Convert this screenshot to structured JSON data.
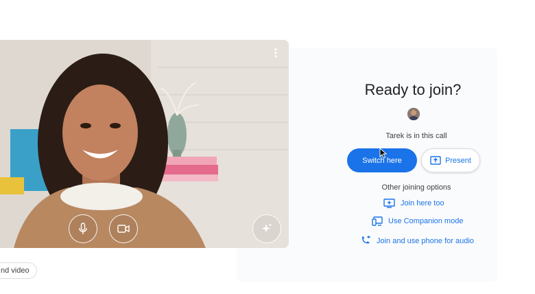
{
  "preview": {
    "chip_label": "nd video"
  },
  "panel": {
    "title": "Ready to join?",
    "in_call_text": "Tarek is in this call",
    "switch_label": "Switch here",
    "present_label": "Present",
    "other_options_label": "Other joining options",
    "options": [
      {
        "label": "Join here too",
        "icon": "add-to-screen-icon"
      },
      {
        "label": "Use Companion mode",
        "icon": "companion-devices-icon"
      },
      {
        "label": "Join and use phone for audio",
        "icon": "phone-forward-icon"
      }
    ]
  },
  "colors": {
    "accent": "#1a73e8",
    "text": "#202124",
    "muted": "#3c4043"
  }
}
